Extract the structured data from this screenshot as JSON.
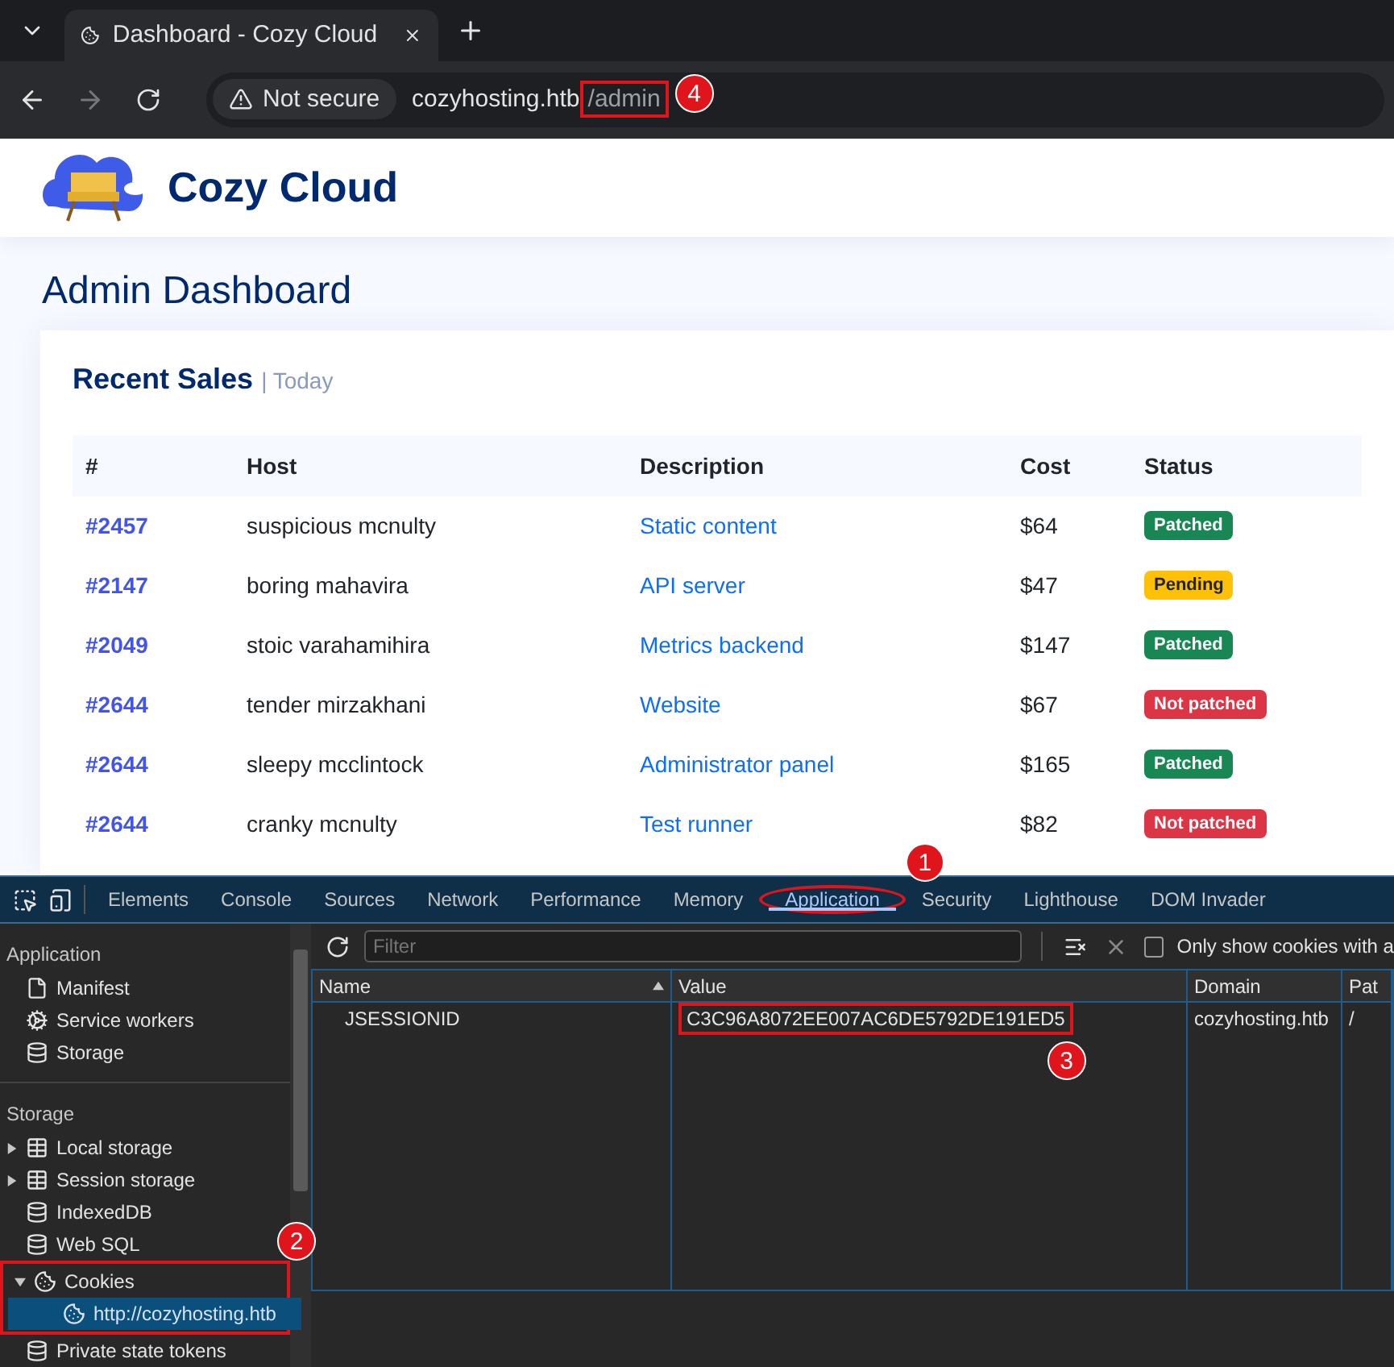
{
  "browser": {
    "tab_title": "Dashboard - Cozy Cloud",
    "security": "Not secure",
    "url_host": "cozyhosting.htb",
    "url_path": "/admin",
    "url_marker": {
      "number": "4"
    }
  },
  "site": {
    "brand": "Cozy Cloud",
    "page_title": "Admin Dashboard",
    "card_title": "Recent Sales",
    "card_subtitle": "| Today",
    "columns": [
      "#",
      "Host",
      "Description",
      "Cost",
      "Status"
    ],
    "rows": [
      {
        "id": "#2457",
        "host": "suspicious mcnulty",
        "description": "Static content",
        "cost": "$64",
        "status": "Patched",
        "kind": "patched"
      },
      {
        "id": "#2147",
        "host": "boring mahavira",
        "description": "API server",
        "cost": "$47",
        "status": "Pending",
        "kind": "pending"
      },
      {
        "id": "#2049",
        "host": "stoic varahamihira",
        "description": "Metrics backend",
        "cost": "$147",
        "status": "Patched",
        "kind": "patched"
      },
      {
        "id": "#2644",
        "host": "tender mirzakhani",
        "description": "Website",
        "cost": "$67",
        "status": "Not patched",
        "kind": "not_patched"
      },
      {
        "id": "#2644",
        "host": "sleepy mcclintock",
        "description": "Administrator panel",
        "cost": "$165",
        "status": "Patched",
        "kind": "patched"
      },
      {
        "id": "#2644",
        "host": "cranky mcnulty",
        "description": "Test runner",
        "cost": "$82",
        "status": "Not patched",
        "kind": "not_patched"
      }
    ]
  },
  "devtools": {
    "tabs": [
      {
        "label": "Elements",
        "selected": false
      },
      {
        "label": "Console",
        "selected": false
      },
      {
        "label": "Sources",
        "selected": false
      },
      {
        "label": "Network",
        "selected": false
      },
      {
        "label": "Performance",
        "selected": false
      },
      {
        "label": "Memory",
        "selected": false
      },
      {
        "label": "Application",
        "selected": true,
        "marker": {
          "number": "1"
        }
      },
      {
        "label": "Security",
        "selected": false
      },
      {
        "label": "Lighthouse",
        "selected": false
      },
      {
        "label": "DOM Invader",
        "selected": false
      }
    ],
    "sidebar": [
      {
        "heading": "Application",
        "items": [
          {
            "label": "Manifest",
            "kind": "file"
          },
          {
            "label": "Service workers",
            "kind": "gears"
          },
          {
            "label": "Storage",
            "kind": "db"
          }
        ]
      },
      {
        "heading": "Storage",
        "items": [
          {
            "label": "Local storage",
            "kind": "table",
            "expanded": false,
            "selected": false
          },
          {
            "label": "Session storage",
            "kind": "table",
            "expanded": false,
            "selected": false
          },
          {
            "label": "IndexedDB",
            "kind": "db"
          },
          {
            "label": "Web SQL",
            "kind": "db"
          },
          {
            "label": "Cookies",
            "kind": "cookie",
            "expanded": true,
            "selected": false,
            "marker": {
              "number": "2"
            },
            "children": [
              {
                "label": "http://cozyhosting.htb",
                "kind": "cookie",
                "selected": true
              }
            ]
          },
          {
            "label": "Private state tokens",
            "kind": "db"
          }
        ]
      }
    ],
    "filter_placeholder": "Filter",
    "only_show_label": "Only show cookies with a",
    "only_show_checked": false,
    "cookie_columns": [
      "Name",
      "Value",
      "Domain",
      "Pat"
    ],
    "cookies": [
      {
        "name": "JSESSIONID",
        "value": "C3C96A8072EE007AC6DE5792DE191ED5",
        "domain": "cozyhosting.htb",
        "path": "/",
        "value_marker": {
          "number": "3"
        }
      }
    ]
  }
}
